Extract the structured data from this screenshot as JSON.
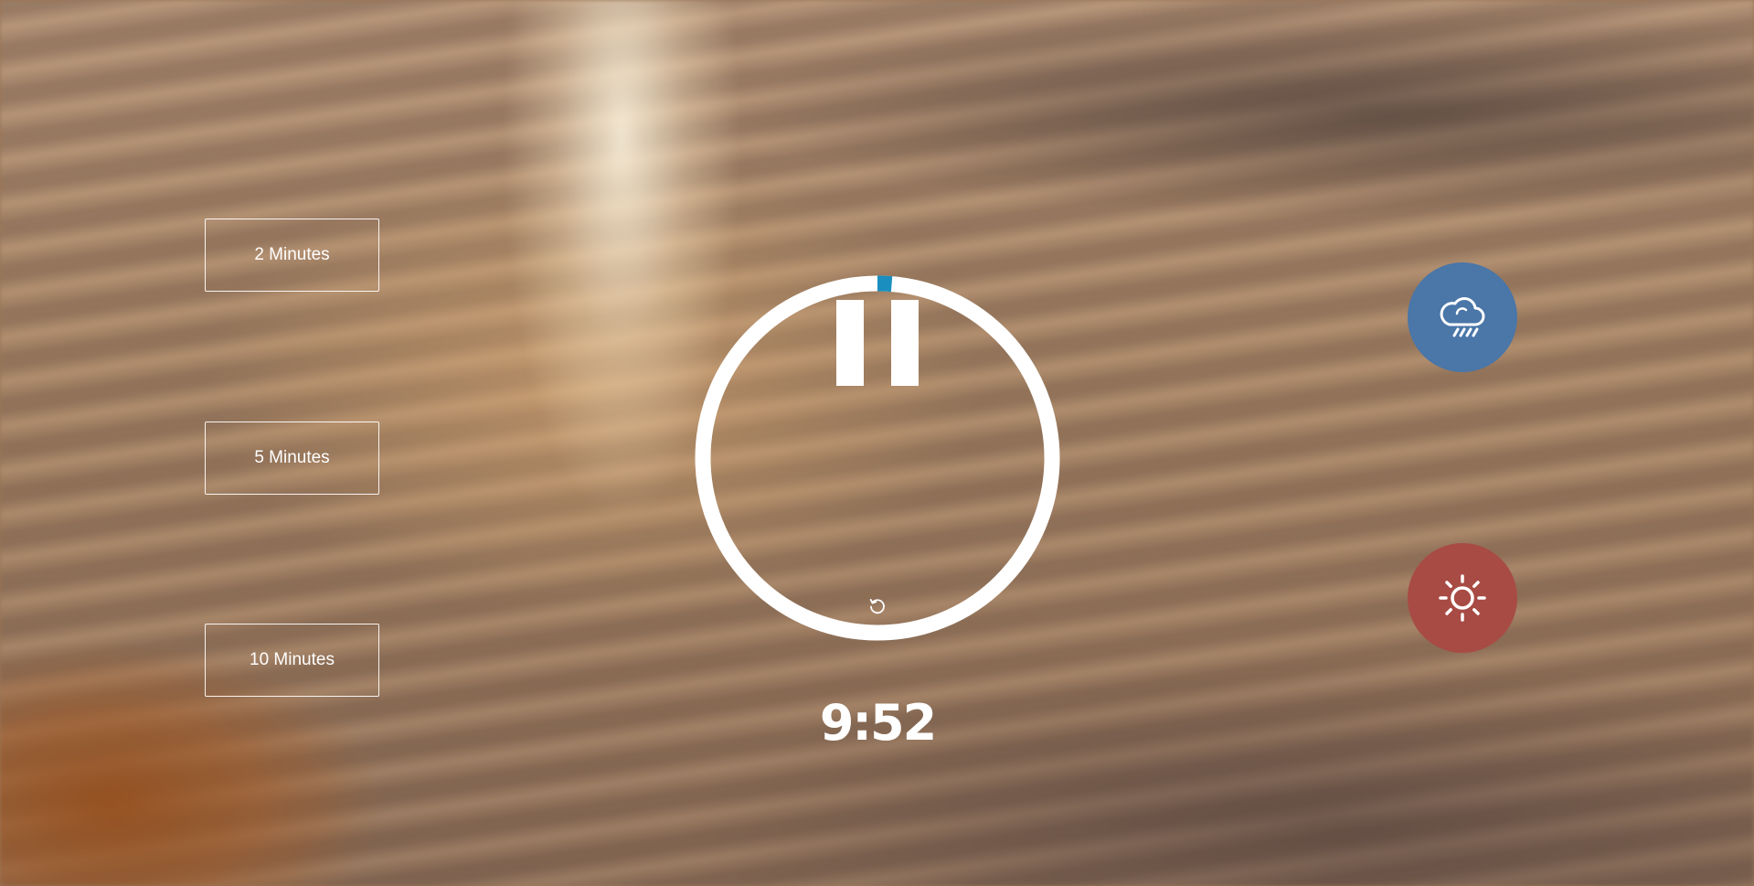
{
  "durations": {
    "two_minutes": "2 Minutes",
    "five_minutes": "5 Minutes",
    "ten_minutes": "10 Minutes"
  },
  "timer": {
    "time": "9:52",
    "progress_fraction": 0.013,
    "ring_color": "#ffffff",
    "progress_color": "#1a8fbf",
    "pause_icon": "pause-icon",
    "reset_icon": "reset-icon"
  },
  "sounds": [
    {
      "name": "rain",
      "icon": "rain-cloud-icon",
      "color": "#4a76a8"
    },
    {
      "name": "sun",
      "icon": "sun-icon",
      "color": "#a84b44"
    }
  ]
}
